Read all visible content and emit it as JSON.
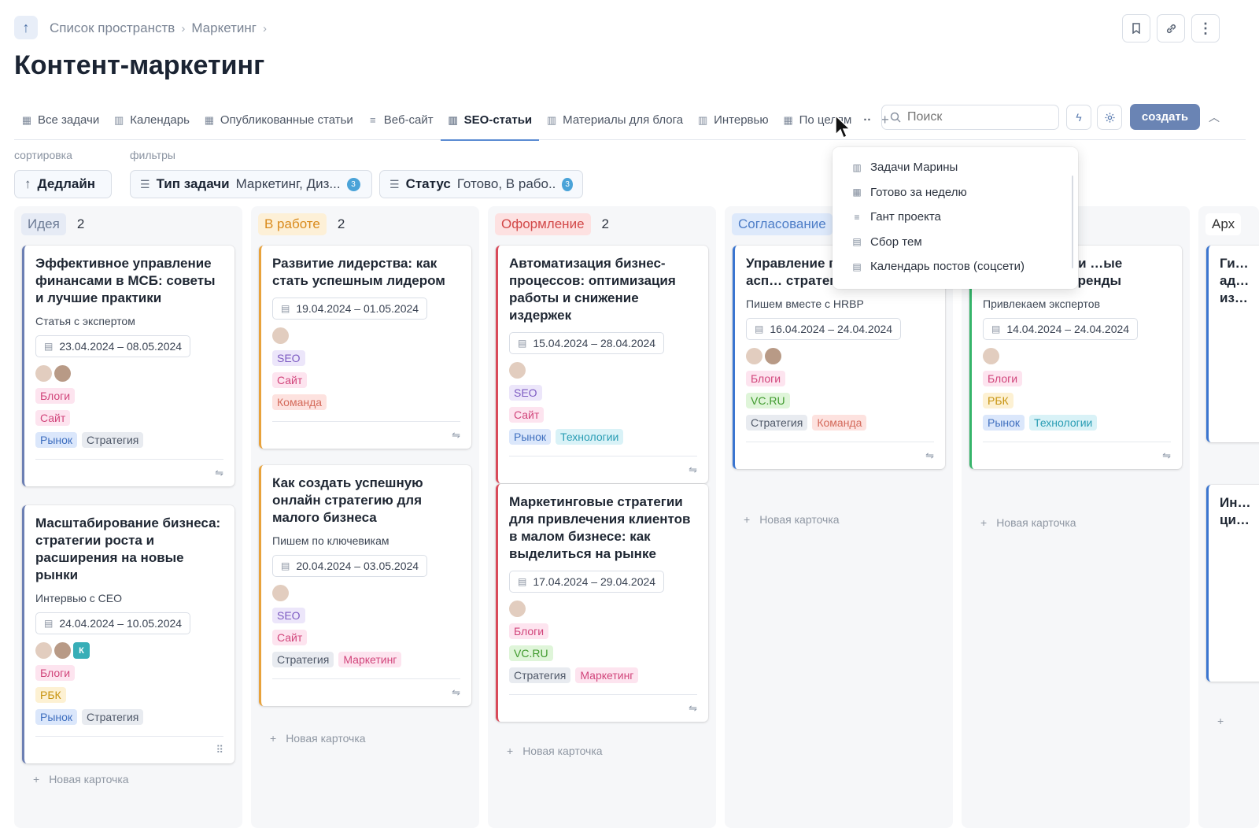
{
  "breadcrumb": {
    "items": [
      "Список пространств",
      "Маркетинг"
    ],
    "sep": "›"
  },
  "page_title": "Контент-маркетинг",
  "header_buttons": {
    "bookmark": "⌑",
    "link": "🔗",
    "more": "⋮"
  },
  "tabs": [
    {
      "label": "Все задачи",
      "icon": "▦"
    },
    {
      "label": "Календарь",
      "icon": "▥"
    },
    {
      "label": "Опубликованные статьи",
      "icon": "▦"
    },
    {
      "label": "Веб-сайт",
      "icon": "≡"
    },
    {
      "label": "SEO-статьи",
      "icon": "▥",
      "active": true
    },
    {
      "label": "Материалы для блога",
      "icon": "▥"
    },
    {
      "label": "Интервью",
      "icon": "▥"
    },
    {
      "label": "По целям",
      "icon": "▦"
    }
  ],
  "tabs_more": "··",
  "tabs_add": "+",
  "search": {
    "placeholder": "Поиск"
  },
  "create_label": "создать",
  "sort_label": "сортировка",
  "filters_label": "фильтры",
  "sort": {
    "label": "Дедлайн"
  },
  "filters": [
    {
      "name": "Тип задачи",
      "value": "Маркетинг, Диз...",
      "count": "3"
    },
    {
      "name": "Статус",
      "value": "Готово, В рабо..",
      "count": "3"
    }
  ],
  "dropdown": [
    "Задачи Марины",
    "Готово за неделю",
    "Гант проекта",
    "Сбор тем",
    "Календарь постов (соцсети)"
  ],
  "new_card_label": "Новая карточка",
  "colors": {
    "accent": "#5b8bd2",
    "create": "#6a84b4"
  },
  "columns": [
    {
      "stage": "Идея",
      "count": "2",
      "cards": [
        {
          "title": "Эффективное управление финансами в МСБ: советы и лучшие практики",
          "subtitle": "Статья с экспертом",
          "date": "23.04.2024 – 08.05.2024",
          "tags": [
            [
              "Блоги"
            ],
            [
              "Сайт"
            ],
            [
              "Рынок",
              "Стратегия"
            ]
          ]
        },
        {
          "title": "Масштабирование бизнеса: стратегии роста и расширения на новые рынки",
          "subtitle": "Интервью с CEO",
          "date": "24.04.2024 – 10.05.2024",
          "avatar_k": "К",
          "tags": [
            [
              "Блоги"
            ],
            [
              "РБК"
            ],
            [
              "Рынок",
              "Стратегия"
            ]
          ]
        }
      ]
    },
    {
      "stage": "В работе",
      "count": "2",
      "cards": [
        {
          "title": "Развитие лидерства: как стать успешным лидером",
          "date": "19.04.2024 – 01.05.2024",
          "tags": [
            [
              "SEO"
            ],
            [
              "Сайт"
            ],
            [
              "Команда"
            ]
          ]
        },
        {
          "title": "Как создать успешную онлайн стратегию для малого бизнеса",
          "subtitle": "Пишем по ключевикам",
          "date": "20.04.2024 – 03.05.2024",
          "tags": [
            [
              "SEO"
            ],
            [
              "Сайт"
            ],
            [
              "Стратегия",
              "Маркетинг"
            ]
          ]
        }
      ]
    },
    {
      "stage": "Оформление",
      "count": "2",
      "cards": [
        {
          "title": "Автоматизация бизнес-процессов: оптимизация работы и снижение издержек",
          "date": "15.04.2024 – 28.04.2024",
          "tags": [
            [
              "SEO"
            ],
            [
              "Сайт"
            ],
            [
              "Рынок",
              "Технологии"
            ]
          ]
        },
        {
          "title": "Маркетинговые стратегии для привлечения клиентов в малом бизнесе: как выделиться на рынке",
          "date": "17.04.2024 – 29.04.2024",
          "tags": [
            [
              "Блоги"
            ],
            [
              "VC.RU"
            ],
            [
              "Стратегия",
              "Маркетинг"
            ]
          ]
        }
      ]
    },
    {
      "stage": "Согласование",
      "cards": [
        {
          "title": "Управление п… ключевые асп… стратегии",
          "subtitle": "Пишем вместе с HRBP",
          "date": "16.04.2024 – 24.04.2024",
          "tags": [
            [
              "Блоги"
            ],
            [
              "VC.RU"
            ],
            [
              "Стратегия",
              "Команда"
            ]
          ]
        }
      ]
    },
    {
      "cards": [
        {
          "title": "…ие тенденции …ые инновации и тренды",
          "subtitle": "Привлекаем экспертов",
          "date": "14.04.2024 – 24.04.2024",
          "tags": [
            [
              "Блоги"
            ],
            [
              "РБК"
            ],
            [
              "Рынок",
              "Технологии"
            ]
          ]
        }
      ]
    },
    {
      "stage": "Арх",
      "cards": [
        {
          "title": "Ги… ад… из…"
        },
        {
          "title": "Ин… ци…"
        }
      ]
    }
  ]
}
